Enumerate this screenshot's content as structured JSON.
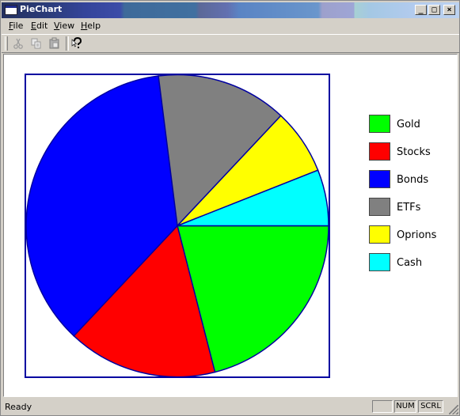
{
  "window": {
    "title": "PieChart",
    "caption_buttons": {
      "minimize": "_",
      "maximize": "□",
      "close": "×"
    }
  },
  "menu": {
    "items": [
      {
        "key": "file",
        "accel": "F",
        "rest": "ile"
      },
      {
        "key": "edit",
        "accel": "E",
        "rest": "dit"
      },
      {
        "key": "view",
        "accel": "V",
        "rest": "iew"
      },
      {
        "key": "help",
        "accel": "H",
        "rest": "elp"
      }
    ]
  },
  "toolbar": {
    "buttons": [
      {
        "key": "cut",
        "icon": "scissors-icon",
        "enabled": false
      },
      {
        "key": "copy",
        "icon": "copy-icon",
        "enabled": false
      },
      {
        "key": "paste",
        "icon": "paste-icon",
        "enabled": false
      },
      {
        "key": "help",
        "icon": "context-help-icon",
        "enabled": true
      }
    ]
  },
  "chart_data": {
    "type": "pie",
    "categories": [
      "Gold",
      "Stocks",
      "Bonds",
      "ETFs",
      "Oprions",
      "Cash"
    ],
    "values": [
      21,
      16,
      36,
      14,
      7,
      6
    ],
    "colors": [
      "#00ff00",
      "#ff0000",
      "#0000ff",
      "#808080",
      "#ffff00",
      "#00ffff"
    ],
    "start_direction": "east",
    "winding": "clockwise",
    "slice_border_color": "#0000a0",
    "frame_color": "#0000a0",
    "legend_position": "right"
  },
  "status": {
    "text": "Ready",
    "panes": [
      "",
      "NUM",
      "SCRL"
    ]
  }
}
